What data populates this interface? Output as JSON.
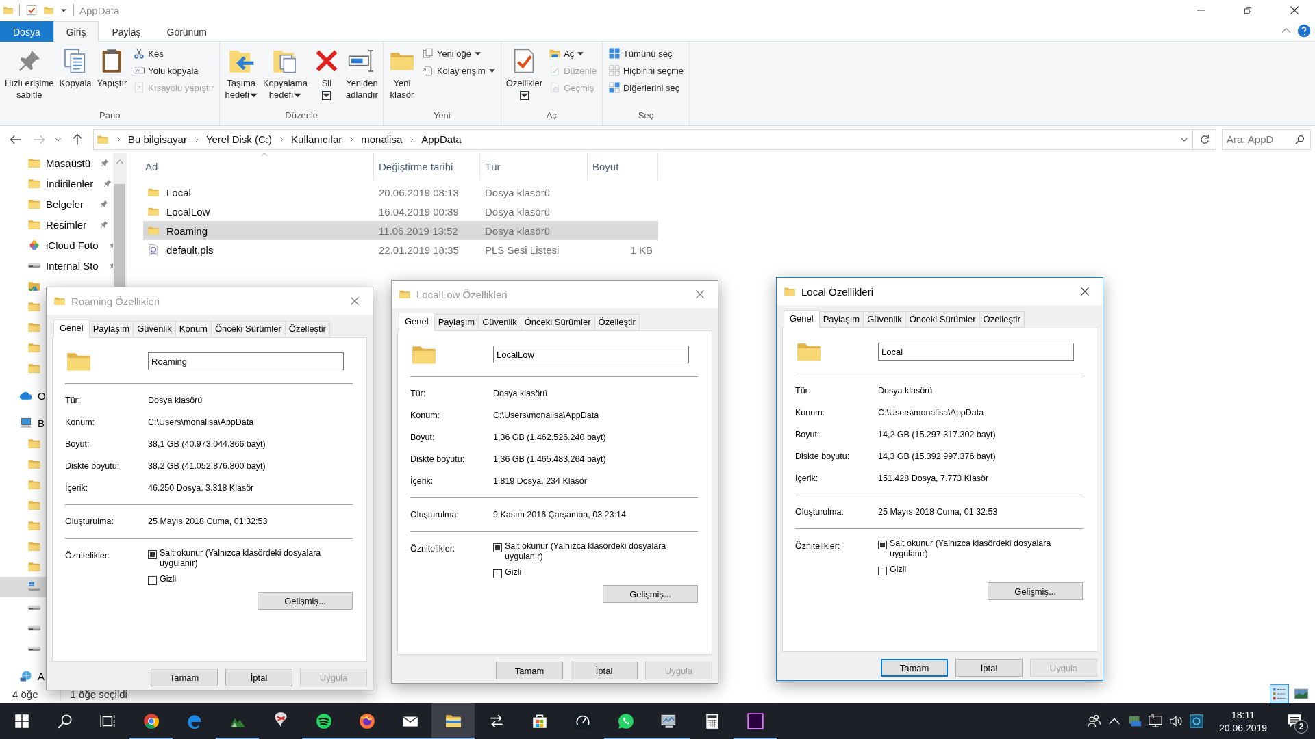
{
  "window": {
    "title": "AppData"
  },
  "ribbon_tabs": [
    {
      "label": "Dosya",
      "kind": "file",
      "selected": false
    },
    {
      "label": "Giriş",
      "kind": "tab",
      "selected": true
    },
    {
      "label": "Paylaş",
      "kind": "tab",
      "selected": false
    },
    {
      "label": "Görünüm",
      "kind": "tab",
      "selected": false
    }
  ],
  "ribbon_groups": [
    {
      "label": "Pano",
      "large": [
        {
          "label": "Hızlı erişime\nsabitle",
          "dropdown": false,
          "disabled": false
        },
        {
          "label": "Kopyala",
          "dropdown": false,
          "disabled": false
        },
        {
          "label": "Yapıştır",
          "dropdown": false,
          "disabled": false
        }
      ],
      "small": [
        {
          "label": "Kes",
          "dropdown": false,
          "disabled": false
        },
        {
          "label": "Yolu kopyala",
          "dropdown": false,
          "disabled": false
        },
        {
          "label": "Kısayolu yapıştır",
          "dropdown": false,
          "disabled": true
        }
      ]
    },
    {
      "label": "Düzenle",
      "large": [
        {
          "label": "Taşıma\nhedefi",
          "dropdown": true,
          "disabled": false
        },
        {
          "label": "Kopyalama\nhedefi",
          "dropdown": true,
          "disabled": false
        },
        {
          "label": "Sil",
          "dropdown": true,
          "disabled": false
        },
        {
          "label": "Yeniden\nadlandır",
          "dropdown": false,
          "disabled": false
        }
      ]
    },
    {
      "label": "Yeni",
      "large": [
        {
          "label": "Yeni\nklasör",
          "dropdown": false,
          "disabled": false
        }
      ],
      "small": [
        {
          "label": "Yeni öğe",
          "dropdown": true,
          "disabled": false
        },
        {
          "label": "Kolay erişim",
          "dropdown": true,
          "disabled": false
        }
      ]
    },
    {
      "label": "Aç",
      "large": [
        {
          "label": "Özellikler",
          "dropdown": true,
          "disabled": false
        }
      ],
      "small": [
        {
          "label": "Aç",
          "dropdown": true,
          "disabled": false
        },
        {
          "label": "Düzenle",
          "dropdown": false,
          "disabled": true
        },
        {
          "label": "Geçmiş",
          "dropdown": false,
          "disabled": true
        }
      ]
    },
    {
      "label": "Seç",
      "small": [
        {
          "label": "Tümünü seç",
          "dropdown": false,
          "disabled": false
        },
        {
          "label": "Hiçbirini seçme",
          "dropdown": false,
          "disabled": false
        },
        {
          "label": "Diğerlerini seç",
          "dropdown": false,
          "disabled": false
        }
      ]
    }
  ],
  "address": {
    "breadcrumb": [
      "Bu bilgisayar",
      "Yerel Disk (C:)",
      "Kullanıcılar",
      "monalisa",
      "AppData"
    ],
    "search": {
      "placeholder": "Ara: AppD"
    }
  },
  "nav": {
    "quick_access": [
      {
        "label": "Masaüstü",
        "kind": "desktop",
        "pinned": true,
        "selected": false
      },
      {
        "label": "İndirilenler",
        "kind": "downloads",
        "pinned": true,
        "selected": false
      },
      {
        "label": "Belgeler",
        "kind": "documents",
        "pinned": true,
        "selected": false
      },
      {
        "label": "Resimler",
        "kind": "pictures",
        "pinned": true,
        "selected": false
      },
      {
        "label": "iCloud Foto",
        "kind": "photos",
        "pinned": true,
        "selected": false
      },
      {
        "label": "Internal Sto",
        "kind": "drive",
        "pinned": true,
        "selected": false
      },
      {
        "kind": "gdrive",
        "pinned": false,
        "selected": false
      },
      {
        "kind": "folder",
        "pinned": false,
        "selected": false
      },
      {
        "kind": "folder",
        "pinned": false,
        "selected": false
      },
      {
        "kind": "folder",
        "pinned": false,
        "selected": false
      },
      {
        "kind": "folder",
        "pinned": false,
        "selected": false
      }
    ],
    "tree": [
      {
        "label": "O",
        "kind": "cloud",
        "selected": false
      },
      {
        "label": "B",
        "kind": "pc",
        "selected": false,
        "children": [
          {
            "kind": "objects",
            "selected": false
          },
          {
            "kind": "documents",
            "selected": false
          },
          {
            "kind": "downloads",
            "selected": false
          },
          {
            "kind": "desktop",
            "selected": false
          },
          {
            "kind": "music",
            "selected": false
          },
          {
            "kind": "pictures",
            "selected": false
          },
          {
            "kind": "videos",
            "selected": false
          },
          {
            "kind": "windrive",
            "selected": true
          },
          {
            "kind": "drive",
            "selected": false
          },
          {
            "kind": "drive",
            "selected": false
          },
          {
            "kind": "drive",
            "selected": false
          }
        ]
      },
      {
        "label": "A",
        "kind": "network",
        "selected": false
      }
    ]
  },
  "files": {
    "columns": [
      "Ad",
      "Değiştirme tarihi",
      "Tür",
      "Boyut"
    ],
    "rows": [
      {
        "name": "Local",
        "date": "20.06.2019 08:13",
        "type": "Dosya klasörü",
        "kind": "folder",
        "selected": false
      },
      {
        "name": "LocalLow",
        "date": "16.04.2019 00:39",
        "type": "Dosya klasörü",
        "kind": "folder",
        "selected": false
      },
      {
        "name": "Roaming",
        "date": "11.06.2019 13:52",
        "type": "Dosya klasörü",
        "kind": "folder",
        "selected": true
      },
      {
        "name": "default.pls",
        "date": "22.01.2019 18:35",
        "type": "PLS Sesi Listesi",
        "size": "1 KB",
        "kind": "playlist",
        "selected": false
      }
    ]
  },
  "status_bar": {
    "count": "4 öğe",
    "selection": "1 öğe seçildi",
    "views": [
      {
        "kind": "details",
        "selected": true
      },
      {
        "kind": "large",
        "selected": false
      }
    ]
  },
  "dialogs": [
    {
      "title": "Roaming Özellikleri",
      "active": false,
      "tabs": [
        {
          "label": "Genel",
          "selected": true
        },
        {
          "label": "Paylaşım",
          "selected": false
        },
        {
          "label": "Güvenlik",
          "selected": false
        },
        {
          "label": "Konum",
          "selected": false
        },
        {
          "label": "Önceki Sürümler",
          "selected": false
        },
        {
          "label": "Özelleştir",
          "selected": false
        }
      ],
      "name": "Roaming",
      "info": [
        {
          "label": "Tür:",
          "value": "Dosya klasörü"
        },
        {
          "label": "Konum:",
          "value": "C:\\Users\\monalisa\\AppData"
        },
        {
          "label": "Boyut:",
          "value": "38,1 GB (40.973.044.366 bayt)"
        },
        {
          "label": "Diskte boyutu:",
          "value": "38,2 GB (41.052.876.800 bayt)"
        },
        {
          "label": "İçerik:",
          "value": "46.250 Dosya, 3.318 Klasör"
        }
      ],
      "created": {
        "label": "Oluşturulma:",
        "value": "25 Mayıs 2018 Cuma, 01:32:53"
      },
      "attributes": {
        "label": "Öznitelikler:",
        "options": [
          {
            "label": "Salt okunur (Yalnızca klasördeki dosyalara uygulanır)",
            "checked": false,
            "indeterminate": true
          },
          {
            "label": "Gizli",
            "checked": false,
            "indeterminate": false
          }
        ]
      },
      "advanced": "Gelişmiş...",
      "buttons": [
        {
          "label": "Tamam",
          "default": false,
          "disabled": false
        },
        {
          "label": "İptal",
          "default": false,
          "disabled": false
        },
        {
          "label": "Uygula",
          "default": false,
          "disabled": true
        }
      ]
    },
    {
      "title": "LocalLow Özellikleri",
      "active": false,
      "tabs": [
        {
          "label": "Genel",
          "selected": true
        },
        {
          "label": "Paylaşım",
          "selected": false
        },
        {
          "label": "Güvenlik",
          "selected": false
        },
        {
          "label": "Önceki Sürümler",
          "selected": false
        },
        {
          "label": "Özelleştir",
          "selected": false
        }
      ],
      "name": "LocalLow",
      "info": [
        {
          "label": "Tür:",
          "value": "Dosya klasörü"
        },
        {
          "label": "Konum:",
          "value": "C:\\Users\\monalisa\\AppData"
        },
        {
          "label": "Boyut:",
          "value": "1,36 GB (1.462.526.240 bayt)"
        },
        {
          "label": "Diskte boyutu:",
          "value": "1,36 GB (1.465.483.264 bayt)"
        },
        {
          "label": "İçerik:",
          "value": "1.819 Dosya, 234 Klasör"
        }
      ],
      "created": {
        "label": "Oluşturulma:",
        "value": "9 Kasım 2016 Çarşamba, 03:23:14"
      },
      "attributes": {
        "label": "Öznitelikler:",
        "options": [
          {
            "label": "Salt okunur (Yalnızca klasördeki dosyalara uygulanır)",
            "checked": false,
            "indeterminate": true
          },
          {
            "label": "Gizli",
            "checked": false,
            "indeterminate": false
          }
        ]
      },
      "advanced": "Gelişmiş...",
      "buttons": [
        {
          "label": "Tamam",
          "default": false,
          "disabled": false
        },
        {
          "label": "İptal",
          "default": false,
          "disabled": false
        },
        {
          "label": "Uygula",
          "default": false,
          "disabled": true
        }
      ]
    },
    {
      "title": "Local Özellikleri",
      "active": true,
      "tabs": [
        {
          "label": "Genel",
          "selected": true
        },
        {
          "label": "Paylaşım",
          "selected": false
        },
        {
          "label": "Güvenlik",
          "selected": false
        },
        {
          "label": "Önceki Sürümler",
          "selected": false
        },
        {
          "label": "Özelleştir",
          "selected": false
        }
      ],
      "name": "Local",
      "info": [
        {
          "label": "Tür:",
          "value": "Dosya klasörü"
        },
        {
          "label": "Konum:",
          "value": "C:\\Users\\monalisa\\AppData"
        },
        {
          "label": "Boyut:",
          "value": "14,2 GB (15.297.317.302 bayt)"
        },
        {
          "label": "Diskte boyutu:",
          "value": "14,3 GB (15.392.997.376 bayt)"
        },
        {
          "label": "İçerik:",
          "value": "151.428 Dosya, 7.773 Klasör"
        }
      ],
      "created": {
        "label": "Oluşturulma:",
        "value": "25 Mayıs 2018 Cuma, 01:32:53"
      },
      "attributes": {
        "label": "Öznitelikler:",
        "options": [
          {
            "label": "Salt okunur (Yalnızca klasördeki dosyalara uygulanır)",
            "checked": false,
            "indeterminate": true
          },
          {
            "label": "Gizli",
            "checked": false,
            "indeterminate": false
          }
        ]
      },
      "advanced": "Gelişmiş...",
      "buttons": [
        {
          "label": "Tamam",
          "default": true,
          "disabled": false
        },
        {
          "label": "İptal",
          "default": false,
          "disabled": false
        },
        {
          "label": "Uygula",
          "default": false,
          "disabled": true
        }
      ]
    }
  ],
  "taskbar": {
    "apps": [
      {
        "kind": "start",
        "running": false,
        "selected": false
      },
      {
        "kind": "search",
        "running": false,
        "selected": false
      },
      {
        "kind": "taskview",
        "running": false,
        "selected": false
      },
      {
        "kind": "chrome",
        "running": true,
        "selected": false
      },
      {
        "kind": "edge",
        "running": false,
        "selected": false
      },
      {
        "kind": "mountain",
        "running": true,
        "selected": false
      },
      {
        "kind": "pinapp",
        "running": false,
        "selected": false
      },
      {
        "kind": "spotify",
        "running": true,
        "selected": false
      },
      {
        "kind": "firefox",
        "running": true,
        "selected": false
      },
      {
        "kind": "mail",
        "running": true,
        "selected": false
      },
      {
        "kind": "explorer",
        "running": true,
        "selected": true
      },
      {
        "kind": "sync",
        "running": false,
        "selected": false
      },
      {
        "kind": "store",
        "running": false,
        "selected": false
      },
      {
        "kind": "gauge",
        "running": false,
        "selected": false
      },
      {
        "kind": "whatsapp",
        "running": true,
        "selected": false
      },
      {
        "kind": "monitor",
        "running": true,
        "selected": false
      },
      {
        "kind": "calculator",
        "running": false,
        "selected": false
      },
      {
        "kind": "premiere",
        "running": true,
        "selected": false
      }
    ],
    "time": "18:11",
    "date": "20.06.2019",
    "notifications": "2"
  }
}
